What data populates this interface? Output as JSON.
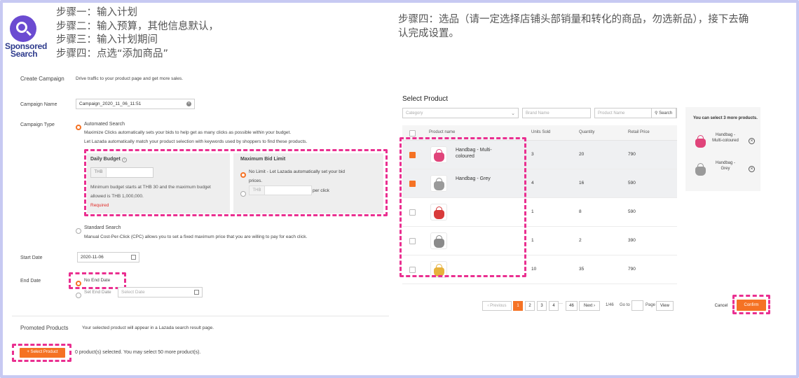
{
  "logo": {
    "line1": "Sponsored",
    "line2": "Search"
  },
  "steps_left": [
    "步骤一：输入计划",
    "步骤二：输入预算，其他信息默认，",
    "步骤三：输入计划期间",
    "步骤四：点选“添加商品”"
  ],
  "step_right": {
    "line1": "步骤四：选品（请一定选择店铺头部销量和转化的商品，勿选新品），接下去确",
    "line2": "认完成设置。"
  },
  "create": {
    "title": "Create Campaign",
    "subtitle": "Drive traffic to your product page and get more sales.",
    "campaign_name_label": "Campaign Name",
    "campaign_name_value": "Campaign_2020_11_06_11:51",
    "campaign_type_label": "Campaign Type",
    "automated_label": "Automated Search",
    "automated_desc1": "Maximize Clicks automatically sets your bids to help get as many clicks as possible within your budget.",
    "automated_desc2": "Let Lazada automatically match your product selection with keywords used by shoppers to find these products.",
    "daily_budget_label": "Daily Budget",
    "currency": "THB",
    "budget_note1": "Minimum budget starts at THB 30 and the maximum budget",
    "budget_note2": "allowed is THB 1,000,000.",
    "required": "Required",
    "max_bid_label": "Maximum Bid Limit",
    "no_limit_line1": "No Limit - Let Lazada automatically set your bid",
    "no_limit_line2": "prices.",
    "per_click": "per click",
    "standard_label": "Standard Search",
    "standard_desc": "Manual Cost-Per-Click (CPC) allows you to set a fixed maximum price that you are willing to pay for each click.",
    "start_date_label": "Start Date",
    "start_date_value": "2020-11-06",
    "end_date_label": "End Date",
    "no_end_date": "No End Date",
    "set_end_date": "Set End Date",
    "select_date_placeholder": "Select Date",
    "promoted_title": "Promoted Products",
    "promoted_desc": "Your selected product will appear in a Lazada search result page.",
    "select_product_btn": "+ Select Product",
    "selected_info": "0 product(s) selected. You may select 50 more product(s)."
  },
  "select": {
    "title": "Select Product",
    "category_placeholder": "Category",
    "brand_placeholder": "Brand Name",
    "product_placeholder": "Product Name",
    "search_label": "Search",
    "columns": [
      "Product name",
      "Units Sold",
      "Quantity",
      "Retail Price"
    ],
    "rows": [
      {
        "checked": true,
        "name": "Handbag - Multi-coloured",
        "units": "3",
        "qty": "20",
        "price": "790",
        "color": "#e0447a"
      },
      {
        "checked": true,
        "name": "Handbag - Grey",
        "units": "4",
        "qty": "16",
        "price": "590",
        "color": "#9a9a9a"
      },
      {
        "checked": false,
        "name": "",
        "units": "1",
        "qty": "8",
        "price": "590",
        "color": "#d83a3a"
      },
      {
        "checked": false,
        "name": "",
        "units": "1",
        "qty": "2",
        "price": "390",
        "color": "#8a8a8a"
      },
      {
        "checked": false,
        "name": "",
        "units": "10",
        "qty": "35",
        "price": "790",
        "color": "#e7b23b"
      }
    ],
    "side_note": "You can select 3 more products.",
    "side_items": [
      {
        "name": "Handbag - Multi-coloured",
        "color": "#e0447a"
      },
      {
        "name": "Handbag - Grey",
        "color": "#9a9a9a"
      }
    ],
    "pagination": {
      "prev": "‹ Previous",
      "pages": [
        "1",
        "2",
        "3",
        "4"
      ],
      "ellipsis": "···",
      "last": "46",
      "next": "Next ›",
      "count": "1/46",
      "goto": "Go to",
      "page": "Page",
      "view": "View"
    },
    "cancel": "Cancel",
    "confirm": "Confirm"
  },
  "colors": {
    "accent": "#f57224",
    "highlight": "#ea2f90",
    "logo": "#6b4bd1"
  }
}
